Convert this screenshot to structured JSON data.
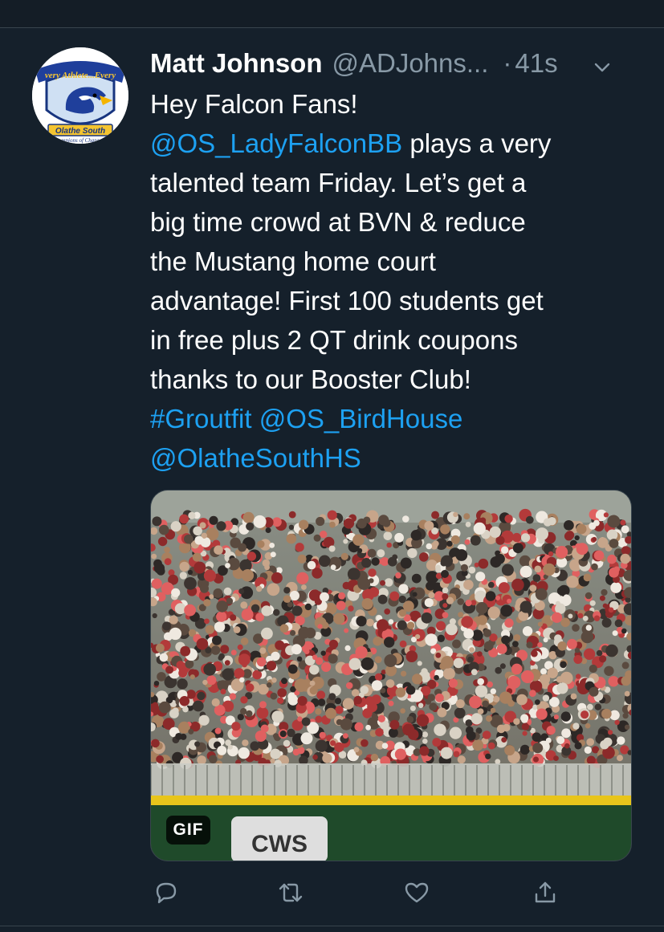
{
  "colors": {
    "background": "#15202b",
    "link": "#1da1f2",
    "secondary_text": "#8899a6",
    "divider": "#38444d"
  },
  "tweet": {
    "author_name": "Matt Johnson",
    "author_handle": "@ADJohns...",
    "separator": "·",
    "timestamp": "41s",
    "avatar": {
      "logo_top_text": "very Athlete...Every",
      "logo_banner_text": "Olathe South",
      "logo_bottom_text": "mpions of Chara"
    },
    "text_lines": {
      "l1": "Hey Falcon Fans!",
      "l2_mention": "@OS_LadyFalconBB",
      "l2_rest": " plays a very",
      "l3": "talented team Friday. Let’s get a",
      "l4": "big time crowd at BVN & reduce",
      "l5": "the Mustang home court",
      "l6": "advantage! First 100 students get",
      "l7": "in free plus 2 QT drink coupons",
      "l8": "thanks to our Booster Club!",
      "l9_hashtag": "#Groutfit",
      "l9_mention": " @OS_BirdHouse",
      "l10_mention": "@OlatheSouthHS"
    },
    "media": {
      "badge": "GIF",
      "board_text": "CWS"
    },
    "actions": {
      "reply_icon": "reply-icon",
      "retweet_icon": "retweet-icon",
      "like_icon": "heart-icon",
      "share_icon": "share-icon"
    }
  }
}
